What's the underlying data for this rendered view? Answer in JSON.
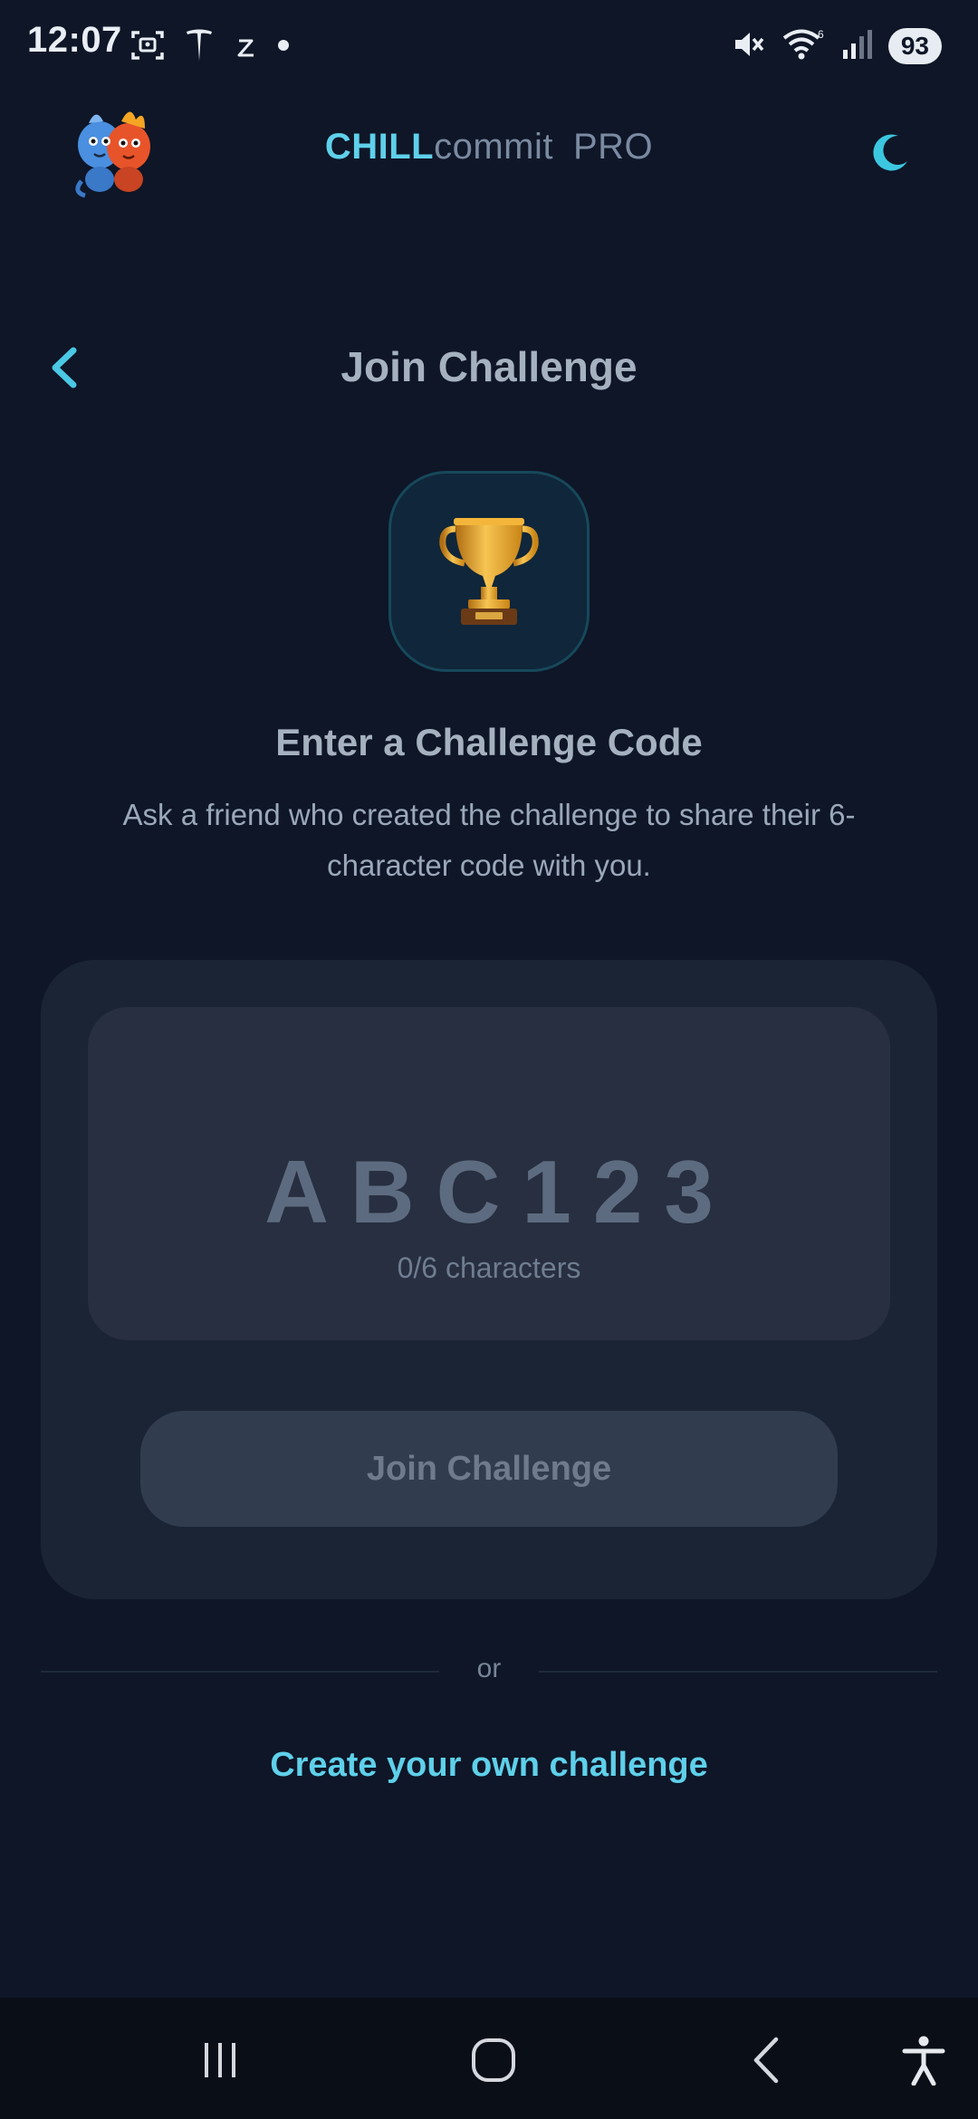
{
  "status_bar": {
    "time": "12:07",
    "battery": "93",
    "icons_left": [
      "screenshot-icon",
      "tesla-icon",
      "sleep-icon",
      "dot-icon"
    ],
    "icons_right": [
      "mute-icon",
      "wifi-icon",
      "signal-icon",
      "battery-icon"
    ]
  },
  "header": {
    "brand_chill": "CHILL",
    "brand_commit": "commit",
    "brand_pro": "PRO",
    "logo_icon": "mascot-logo",
    "theme_icon": "moon-icon"
  },
  "page": {
    "title": "Join Challenge",
    "back_icon": "chevron-left-icon"
  },
  "hero": {
    "icon": "trophy-icon",
    "glyph": "🏆",
    "heading": "Enter a Challenge Code",
    "description": "Ask a friend who created the challenge to share their 6-character code with you."
  },
  "code_input": {
    "placeholder": "ABC123",
    "char_count": "0/6 characters"
  },
  "join_button": {
    "label": "Join Challenge"
  },
  "divider": {
    "text": "or"
  },
  "create_link": {
    "label": "Create your own challenge"
  },
  "nav_bar": {
    "items": [
      "recents-icon",
      "home-icon",
      "back-icon",
      "accessibility-icon"
    ]
  },
  "colors": {
    "background": "#0e1627",
    "accent": "#5fd0ea",
    "card": "#1a2435",
    "input": "#272f40"
  }
}
